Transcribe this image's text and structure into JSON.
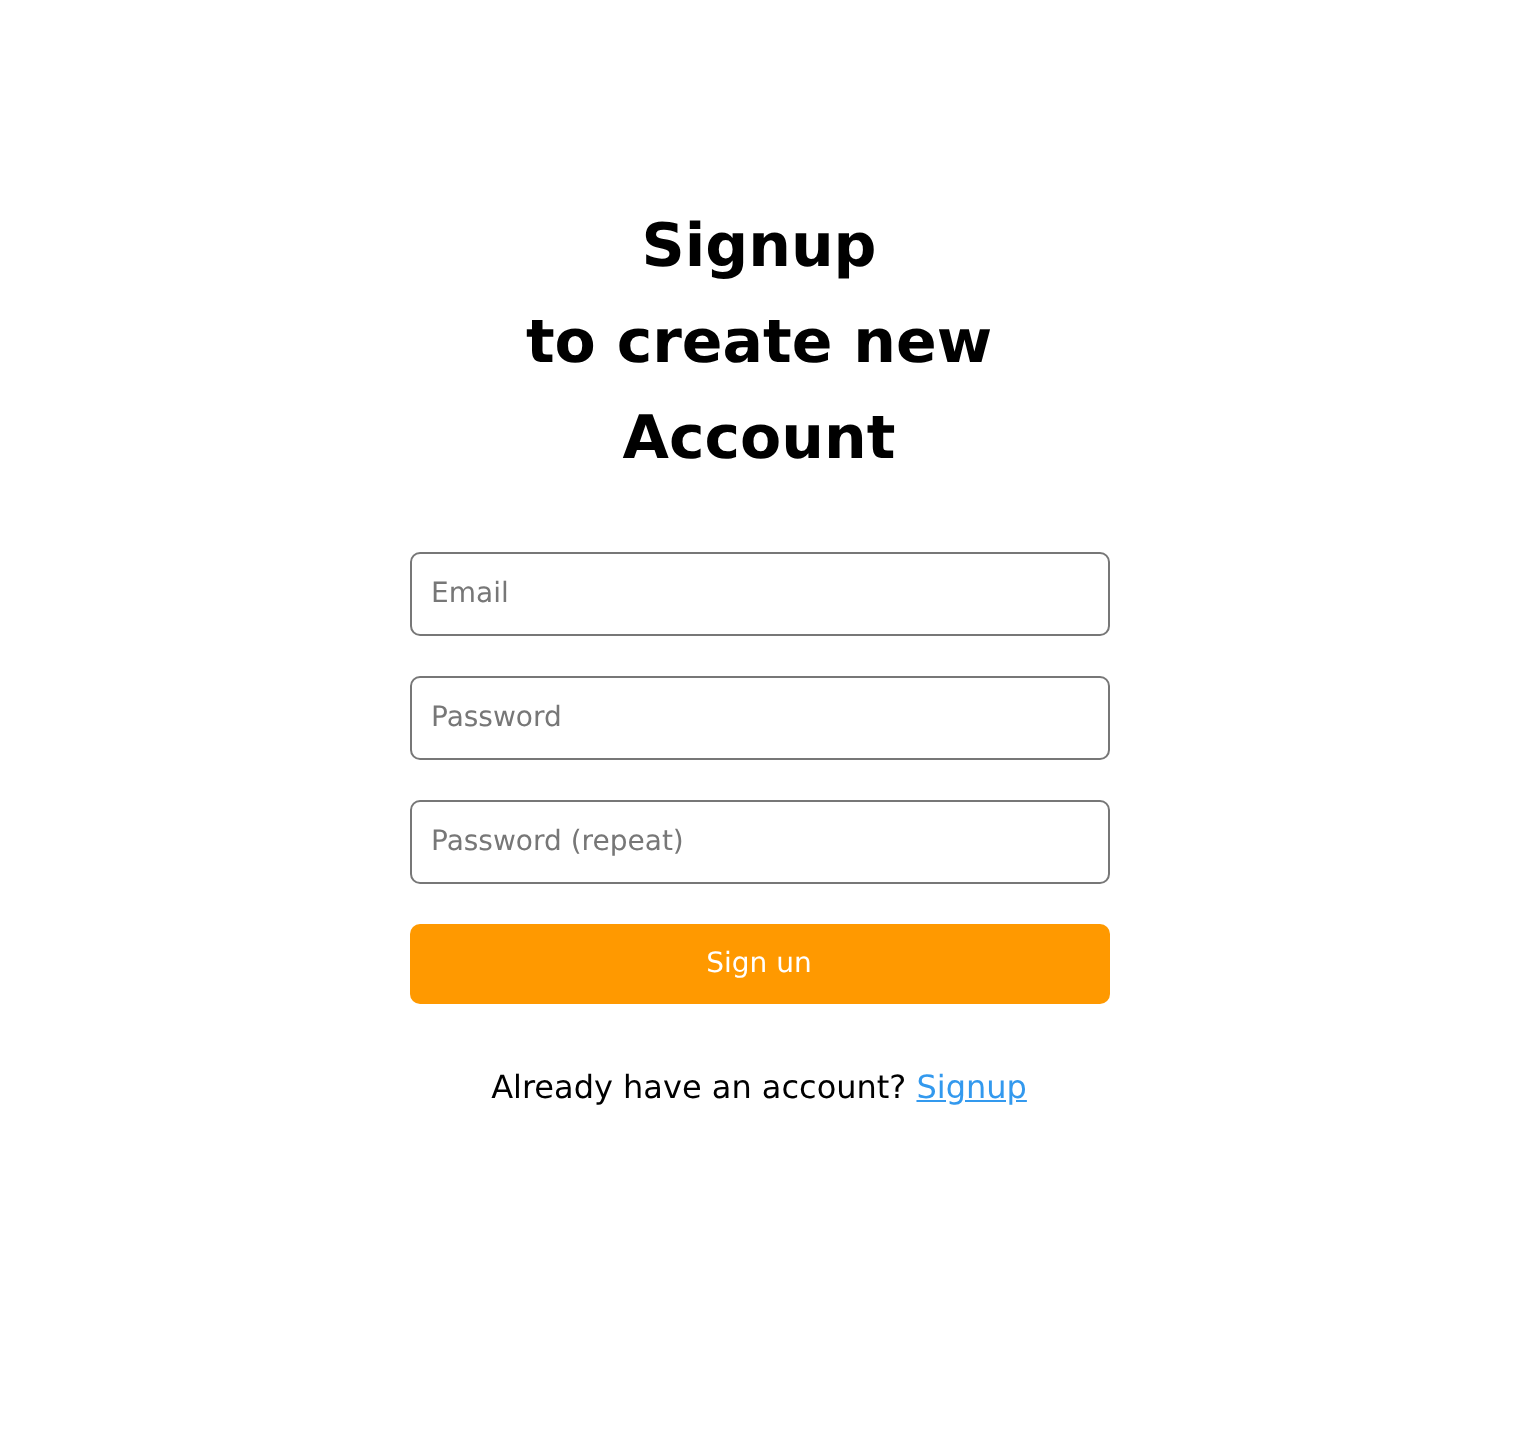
{
  "heading": {
    "lines": [
      "Signup",
      "to create new",
      "Account"
    ]
  },
  "fields": [
    {
      "placeholder": "Email"
    },
    {
      "placeholder": "Password"
    },
    {
      "placeholder": "Password (repeat)"
    }
  ],
  "submit_button": {
    "label": "Sign un"
  },
  "footer": {
    "text": "Already have an account?",
    "link": "Signup"
  }
}
